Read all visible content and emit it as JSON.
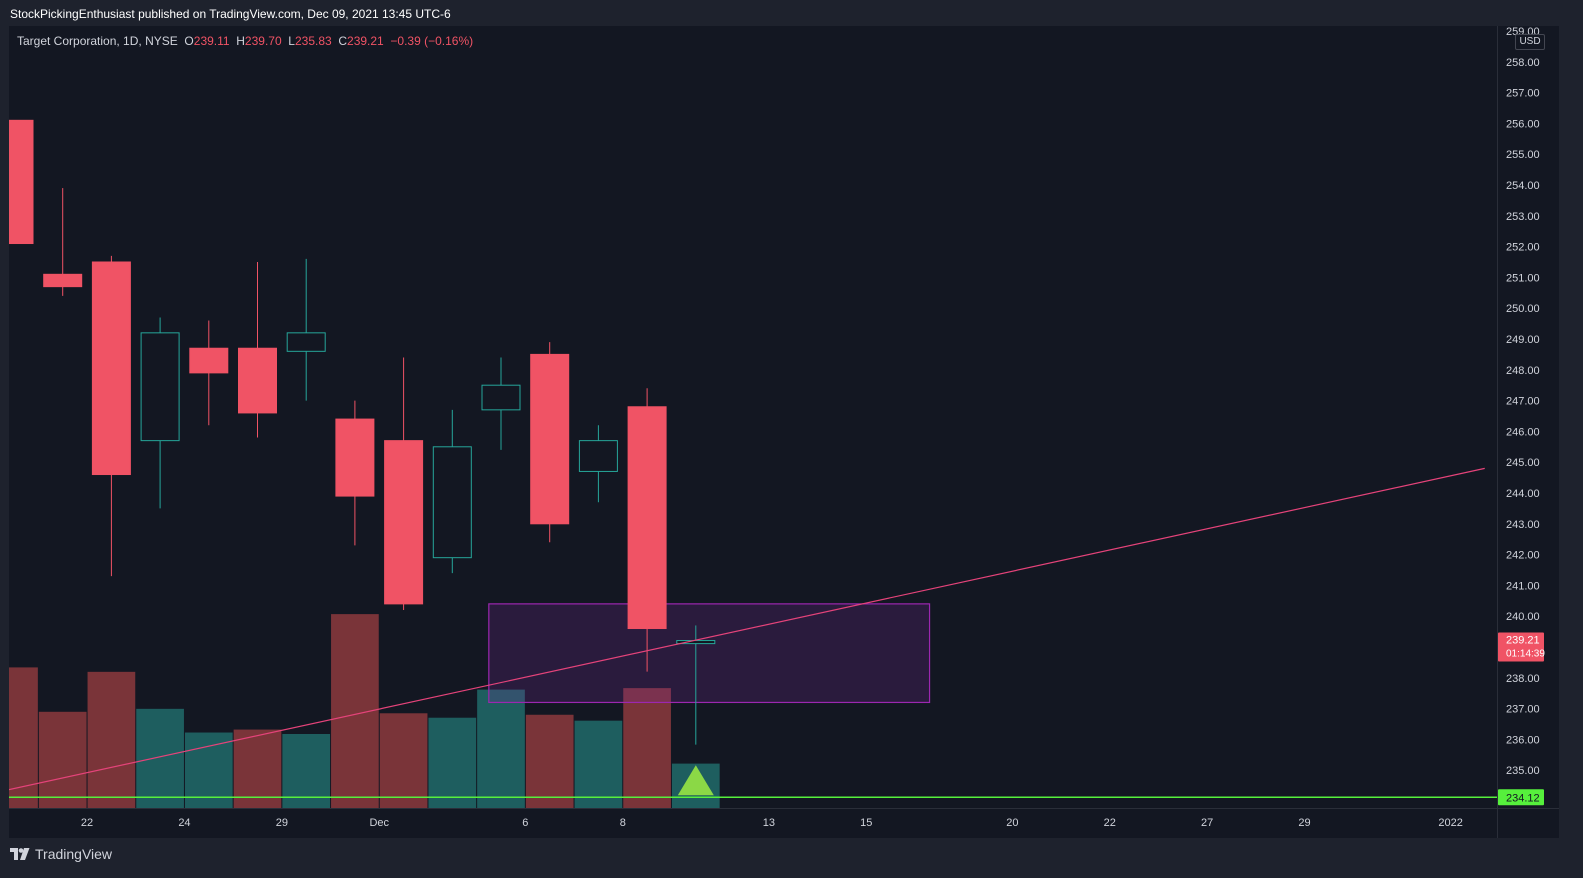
{
  "header": {
    "publish_line": "StockPickingEnthusiast published on TradingView.com, Dec 09, 2021 13:45 UTC-6"
  },
  "legend": {
    "symbol": "Target Corporation, 1D, NYSE",
    "o_label": "O",
    "o_value": "239.11",
    "h_label": "H",
    "h_value": "239.70",
    "l_label": "L",
    "l_value": "235.83",
    "c_label": "C",
    "c_value": "239.21",
    "change": "−0.39 (−0.16%)"
  },
  "currency": "USD",
  "footer": {
    "brand": "TradingView"
  },
  "colors": {
    "up": "#26a69a",
    "down": "#f05365",
    "up_volume": "#1e5e5f",
    "down_volume": "#7a3439",
    "trendline": "#e5437a",
    "zone_border": "#9c27b0",
    "support": "#56f03c",
    "marker": "#8bd846"
  },
  "chart_data": {
    "type": "candlestick",
    "ylim": [
      233.7,
      259.0
    ],
    "y_ticks": [
      "259.00",
      "258.00",
      "257.00",
      "256.00",
      "255.00",
      "254.00",
      "253.00",
      "252.00",
      "251.00",
      "250.00",
      "249.00",
      "248.00",
      "247.00",
      "246.00",
      "245.00",
      "244.00",
      "243.00",
      "242.00",
      "241.00",
      "240.00",
      "239.00",
      "238.00",
      "237.00",
      "236.00",
      "235.00",
      "234.00"
    ],
    "x_ticks": [
      {
        "label": "22",
        "slot": 1.5
      },
      {
        "label": "24",
        "slot": 3.5
      },
      {
        "label": "29",
        "slot": 5.5
      },
      {
        "label": "Dec",
        "slot": 7.5
      },
      {
        "label": "6",
        "slot": 10.5
      },
      {
        "label": "8",
        "slot": 12.5
      },
      {
        "label": "13",
        "slot": 15.5
      },
      {
        "label": "15",
        "slot": 17.5
      },
      {
        "label": "20",
        "slot": 20.5
      },
      {
        "label": "22",
        "slot": 22.5
      },
      {
        "label": "27",
        "slot": 24.5
      },
      {
        "label": "29",
        "slot": 26.5
      },
      {
        "label": "2022",
        "slot": 29.5
      }
    ],
    "candles": [
      {
        "o": 256.1,
        "h": 256.1,
        "l": 252.1,
        "c": 252.1
      },
      {
        "o": 251.1,
        "h": 253.9,
        "l": 250.4,
        "c": 250.7
      },
      {
        "o": 251.5,
        "h": 251.7,
        "l": 241.3,
        "c": 244.6
      },
      {
        "o": 245.7,
        "h": 249.7,
        "l": 243.5,
        "c": 249.2
      },
      {
        "o": 248.7,
        "h": 249.6,
        "l": 246.2,
        "c": 247.9
      },
      {
        "o": 248.7,
        "h": 251.5,
        "l": 245.8,
        "c": 246.6
      },
      {
        "o": 248.6,
        "h": 251.6,
        "l": 247.0,
        "c": 249.2
      },
      {
        "o": 246.4,
        "h": 247.0,
        "l": 242.3,
        "c": 243.9
      },
      {
        "o": 245.7,
        "h": 248.4,
        "l": 240.2,
        "c": 240.4
      },
      {
        "o": 241.9,
        "h": 246.7,
        "l": 241.4,
        "c": 245.5
      },
      {
        "o": 246.7,
        "h": 248.4,
        "l": 245.4,
        "c": 247.5
      },
      {
        "o": 248.5,
        "h": 248.9,
        "l": 242.4,
        "c": 243.0
      },
      {
        "o": 244.7,
        "h": 246.2,
        "l": 243.7,
        "c": 245.7
      },
      {
        "o": 246.8,
        "h": 247.4,
        "l": 238.2,
        "c": 239.6
      },
      {
        "o": 239.11,
        "h": 239.7,
        "l": 235.83,
        "c": 239.21
      }
    ],
    "volume": [
      {
        "v": 0.95,
        "dir": "down"
      },
      {
        "v": 0.65,
        "dir": "down"
      },
      {
        "v": 0.92,
        "dir": "down"
      },
      {
        "v": 0.67,
        "dir": "up"
      },
      {
        "v": 0.51,
        "dir": "up"
      },
      {
        "v": 0.53,
        "dir": "down"
      },
      {
        "v": 0.5,
        "dir": "up"
      },
      {
        "v": 1.31,
        "dir": "down"
      },
      {
        "v": 0.64,
        "dir": "down"
      },
      {
        "v": 0.61,
        "dir": "up"
      },
      {
        "v": 0.8,
        "dir": "up"
      },
      {
        "v": 0.63,
        "dir": "down"
      },
      {
        "v": 0.59,
        "dir": "up"
      },
      {
        "v": 0.81,
        "dir": "down"
      },
      {
        "v": 0.3,
        "dir": "up"
      }
    ],
    "trendline": {
      "start": {
        "slot": -0.3,
        "price": 234.3
      },
      "end": {
        "slot": 30.2,
        "price": 244.8
      }
    },
    "zone": {
      "slot_from": 9.75,
      "slot_to": 18.8,
      "price_top": 240.4,
      "price_bottom": 237.2
    },
    "support": {
      "price": 234.12,
      "label": "234.12"
    },
    "last_price": {
      "price": 239.21,
      "label": "239.21",
      "countdown": "01:14:39"
    },
    "marker": {
      "slot": 14.0,
      "shape": "triangle-up"
    }
  }
}
